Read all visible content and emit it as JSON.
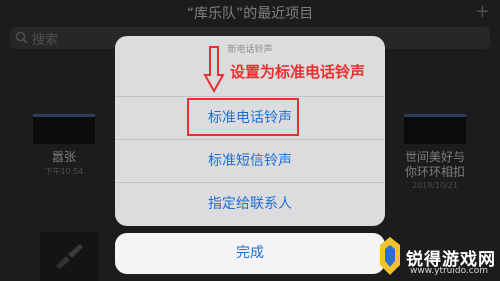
{
  "header": {
    "title": "“库乐队”的最近项目",
    "add_icon": "plus-icon"
  },
  "search": {
    "placeholder": "搜索",
    "icon": "search-icon"
  },
  "songs": [
    {
      "title": "嚣张",
      "meta": "下午10:54"
    },
    {
      "title": "世间美好与你环环相扣",
      "meta": "2019/10/21"
    }
  ],
  "action_sheet": {
    "title": "新电话铃声",
    "options": [
      "标准电话铃声",
      "标准短信铃声",
      "指定给联系人"
    ],
    "cancel_label": "完成"
  },
  "annotation": {
    "text": "设置为标准电话铃声",
    "color": "#e8312f"
  },
  "watermark": {
    "name": "锐得游戏网",
    "url": "www.ytruido.com"
  },
  "colors": {
    "accent": "#1d70d6",
    "annotation": "#e8312f",
    "background": "#333335"
  }
}
